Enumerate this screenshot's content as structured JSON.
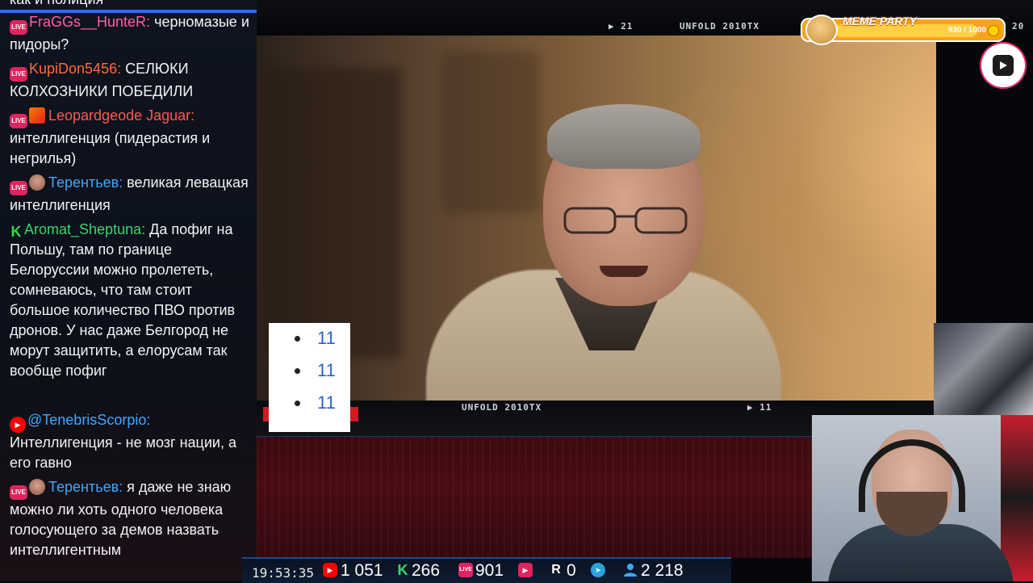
{
  "chat": {
    "messages": [
      {
        "platform": "vk",
        "nick": "",
        "text": "как и полиция",
        "nick_color": "#f3f3f3"
      },
      {
        "platform": "vk",
        "nick": "FraGGs__HunteR:",
        "text": "черномазые и пидоры?",
        "nick_color": "#ff5ea8"
      },
      {
        "platform": "vk",
        "nick": "KupiDon5456:",
        "text": "СЕЛЮКИ КОЛХОЗНИКИ ПОБЕДИЛИ",
        "nick_color": "#ff6a3d"
      },
      {
        "platform": "vk",
        "nick": "Leopardgeode Jaguar:",
        "text": "интеллигенция (пидерастия и негрилья)",
        "nick_color": "#ff5a4a"
      },
      {
        "platform": "vk",
        "nick": "Терентьев:",
        "text": "великая левацкая интеллигенция",
        "nick_color": "#3fa8ff"
      },
      {
        "platform": "kick",
        "nick": "Aromat_Sheptuna:",
        "text": "Да пофиг на Польшу, там по границе Белоруссии можно пролететь, сомневаюсь, что там стоит большое количество ПВО против дронов. У нас даже Белгород не морут защитить, а елорусам так вообще пофиг",
        "nick_color": "#37d86a"
      },
      {
        "platform": "youtube",
        "nick": "@TenebrisScorpio:",
        "text": "Интеллигенция - не мозг нации, а его гавно",
        "nick_color": "#3fa8ff"
      },
      {
        "platform": "vk",
        "nick": "Терентьев:",
        "text": "я даже не знаю можно ли хоть одного человека голосующего за демов назвать интеллигентным",
        "nick_color": "#3fa8ff"
      }
    ],
    "badge_live": "LIVE"
  },
  "video": {
    "strip_left": "▶ 21",
    "strip_center": "UNFOLD 2010TX",
    "strip_right": "20",
    "bottom_center": "UNFOLD 2010TX",
    "bottom_right": "▶ 11",
    "list_items": [
      "11",
      "11",
      "11"
    ]
  },
  "meme_party": {
    "title": "MEME PARTY",
    "progress": "930 / 1000",
    "progress_fraction": 0.93
  },
  "stats": {
    "time": "19:53:35",
    "youtube": "1 051",
    "kick": "266",
    "vk": "901",
    "rutube": "0",
    "telegram": "",
    "viewers": "2 218"
  },
  "colors": {
    "accent_blue": "#2d6fd6",
    "youtube_red": "#ff0000",
    "kick_green": "#37d86a",
    "vk_pink": "#e0245e"
  },
  "icons": {
    "record": "record-icon",
    "youtube": "youtube-icon",
    "kick": "kick-icon",
    "vk": "vk-live-icon",
    "rutube": "rutube-icon",
    "telegram": "telegram-icon",
    "viewers": "viewers-icon"
  }
}
